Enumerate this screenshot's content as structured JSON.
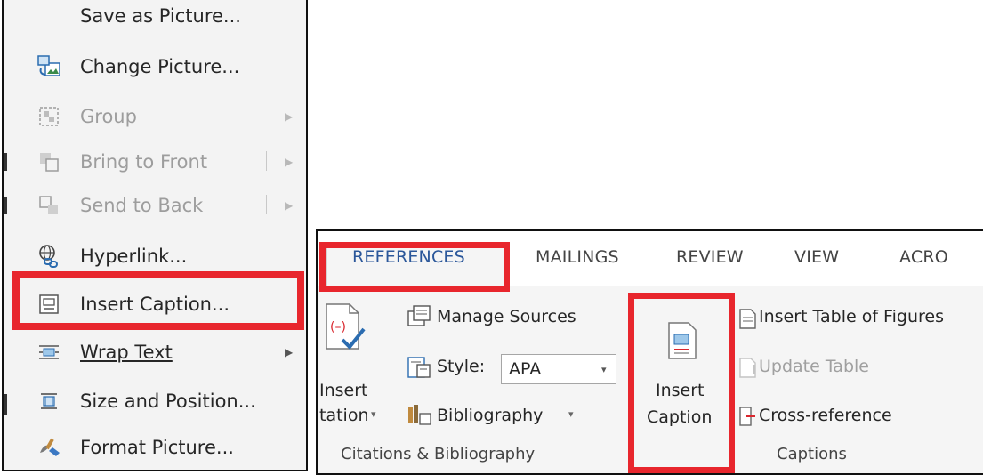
{
  "context_menu": {
    "items": [
      {
        "label": "Save as Picture...",
        "icon": "save-picture-icon",
        "enabled": true
      },
      {
        "label": "Change Picture...",
        "icon": "change-picture-icon",
        "enabled": true
      },
      {
        "label": "Group",
        "icon": "group-icon",
        "enabled": false,
        "submenu": true
      },
      {
        "label": "Bring to Front",
        "icon": "bring-to-front-icon",
        "enabled": false,
        "submenu": true
      },
      {
        "label": "Send to Back",
        "icon": "send-to-back-icon",
        "enabled": false,
        "submenu": true
      },
      {
        "label": "Hyperlink...",
        "icon": "hyperlink-icon",
        "enabled": true
      },
      {
        "label": "Insert Caption...",
        "icon": "insert-caption-icon",
        "enabled": true,
        "highlighted": true
      },
      {
        "label": "Wrap Text",
        "icon": "wrap-text-icon",
        "enabled": true,
        "submenu": true
      },
      {
        "label": "Size and Position...",
        "icon": "size-position-icon",
        "enabled": true
      },
      {
        "label": "Format Picture...",
        "icon": "format-picture-icon",
        "enabled": true
      }
    ],
    "submenu_arrow": "▶"
  },
  "ribbon": {
    "tabs": [
      "REFERENCES",
      "MAILINGS",
      "REVIEW",
      "VIEW",
      "ACRO"
    ],
    "active_tab": "REFERENCES",
    "citations": {
      "insert_citation_line1": "Insert",
      "insert_citation_line2": "tation",
      "manage_sources": "Manage Sources",
      "style_label": "Style:",
      "style_value": "APA",
      "bibliography": "Bibliography",
      "group_label": "Citations & Bibliography"
    },
    "captions": {
      "insert_caption_line1": "Insert",
      "insert_caption_line2": "Caption",
      "insert_table_of_figures": "Insert Table of Figures",
      "update_table": "Update Table",
      "cross_reference": "Cross-reference",
      "group_label": "Captions"
    },
    "dropdown_arrow": "▾"
  },
  "colors": {
    "highlight": "#e8262d",
    "active_tab": "#2b579a",
    "disabled_text": "#9d9d9d"
  }
}
